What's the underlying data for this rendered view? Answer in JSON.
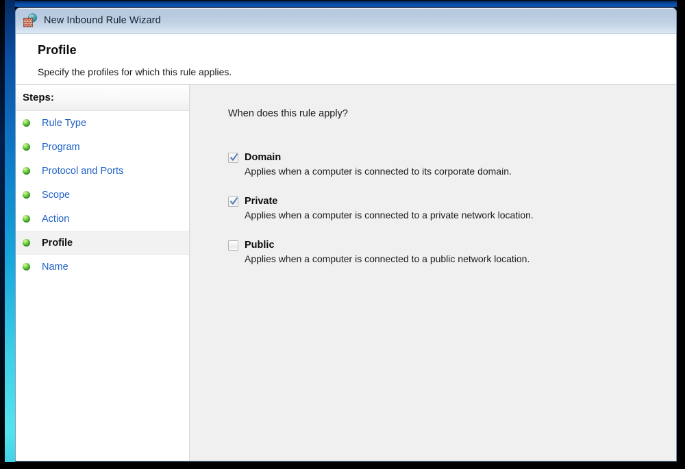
{
  "window": {
    "title": "New Inbound Rule Wizard",
    "icon": "firewall-brick-wall-globe-icon"
  },
  "header": {
    "title": "Profile",
    "subtitle": "Specify the profiles for which this rule applies."
  },
  "sidebar": {
    "heading": "Steps:",
    "items": [
      {
        "label": "Rule Type",
        "active": false
      },
      {
        "label": "Program",
        "active": false
      },
      {
        "label": "Protocol and Ports",
        "active": false
      },
      {
        "label": "Scope",
        "active": false
      },
      {
        "label": "Action",
        "active": false
      },
      {
        "label": "Profile",
        "active": true
      },
      {
        "label": "Name",
        "active": false
      }
    ]
  },
  "main": {
    "question": "When does this rule apply?",
    "options": [
      {
        "label": "Domain",
        "checked": true,
        "description": "Applies when a computer is connected to its corporate domain."
      },
      {
        "label": "Private",
        "checked": true,
        "description": "Applies when a computer is connected to a private network location."
      },
      {
        "label": "Public",
        "checked": false,
        "description": "Applies when a computer is connected to a public network location."
      }
    ]
  },
  "colors": {
    "link": "#1f61c8",
    "bullet_green": "#3fad1c",
    "pane_background": "#f0f0f0",
    "titlebar_top": "#b6c9df",
    "titlebar_bottom": "#dce7f3",
    "frame_accent_cyan": "#3fd0e8",
    "frame_accent_blue": "#0a52ae"
  }
}
